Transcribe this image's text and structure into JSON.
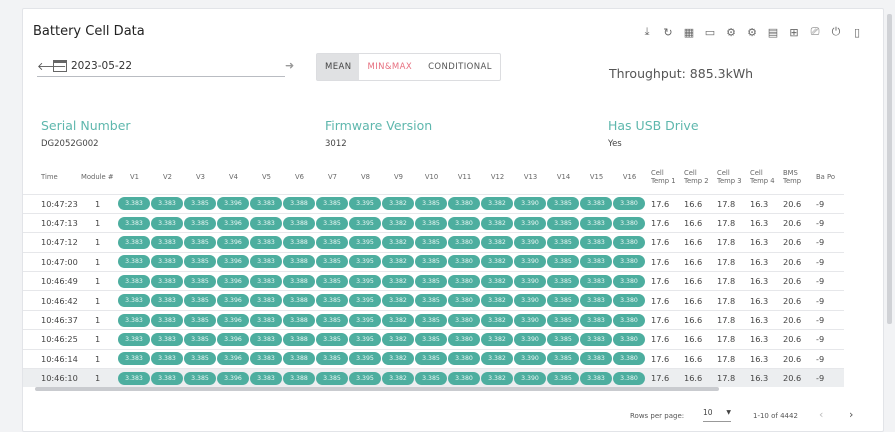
{
  "title": "Battery Cell Data",
  "toolbar_icons": [
    "download-icon",
    "refresh-icon",
    "grid-icon",
    "monitor-icon",
    "settings-cog-icon",
    "settings-alt-icon",
    "list-icon",
    "file-add-icon",
    "cast-icon",
    "power-icon",
    "battery-menu-icon"
  ],
  "toolbar_glyphs": [
    "⤓",
    "↻",
    "▦",
    "▭",
    "⚙",
    "⚙",
    "▤",
    "⊞",
    "⎚",
    "⏻",
    "▯"
  ],
  "date": "2023-05-22",
  "modes": [
    "MEAN",
    "MIN",
    "&",
    "MAX",
    "CONDITIONAL"
  ],
  "throughput": "Throughput: 885.3kWh",
  "info": [
    {
      "label": "Serial Number",
      "value": "DG2052G002"
    },
    {
      "label": "Firmware Version",
      "value": "3012"
    },
    {
      "label": "Has USB Drive",
      "value": "Yes"
    }
  ],
  "columns": [
    "Time",
    "Module #",
    "V1",
    "V2",
    "V3",
    "V4",
    "V5",
    "V6",
    "V7",
    "V8",
    "V9",
    "V10",
    "V11",
    "V12",
    "V13",
    "V14",
    "V15",
    "V16",
    "Cell Temp 1",
    "Cell Temp 2",
    "Cell Temp 3",
    "Cell Temp 4",
    "BMS Temp",
    "Ba Po"
  ],
  "rows": [
    {
      "time": "10:47:23",
      "module": "1",
      "v": [
        "3.383",
        "3.383",
        "3.385",
        "3.396",
        "3.383",
        "3.388",
        "3.385",
        "3.395",
        "3.382",
        "3.385",
        "3.380",
        "3.382",
        "3.390",
        "3.385",
        "3.383",
        "3.380"
      ],
      "t": [
        "17.6",
        "16.6",
        "17.8",
        "16.3",
        "20.6",
        "-9"
      ]
    },
    {
      "time": "10:47:13",
      "module": "1",
      "v": [
        "3.383",
        "3.383",
        "3.385",
        "3.396",
        "3.383",
        "3.388",
        "3.385",
        "3.395",
        "3.382",
        "3.385",
        "3.380",
        "3.382",
        "3.390",
        "3.385",
        "3.383",
        "3.380"
      ],
      "t": [
        "17.6",
        "16.6",
        "17.8",
        "16.3",
        "20.6",
        "-9"
      ]
    },
    {
      "time": "10:47:12",
      "module": "1",
      "v": [
        "3.383",
        "3.383",
        "3.385",
        "3.396",
        "3.383",
        "3.388",
        "3.385",
        "3.395",
        "3.382",
        "3.385",
        "3.380",
        "3.382",
        "3.390",
        "3.385",
        "3.383",
        "3.380"
      ],
      "t": [
        "17.6",
        "16.6",
        "17.8",
        "16.3",
        "20.6",
        "-9"
      ]
    },
    {
      "time": "10:47:00",
      "module": "1",
      "v": [
        "3.383",
        "3.383",
        "3.385",
        "3.396",
        "3.383",
        "3.388",
        "3.385",
        "3.395",
        "3.382",
        "3.385",
        "3.380",
        "3.382",
        "3.390",
        "3.385",
        "3.383",
        "3.380"
      ],
      "t": [
        "17.6",
        "16.6",
        "17.8",
        "16.3",
        "20.6",
        "-9"
      ]
    },
    {
      "time": "10:46:49",
      "module": "1",
      "v": [
        "3.383",
        "3.383",
        "3.385",
        "3.396",
        "3.383",
        "3.388",
        "3.385",
        "3.395",
        "3.382",
        "3.385",
        "3.380",
        "3.382",
        "3.390",
        "3.385",
        "3.383",
        "3.380"
      ],
      "t": [
        "17.6",
        "16.6",
        "17.8",
        "16.3",
        "20.6",
        "-9"
      ]
    },
    {
      "time": "10:46:42",
      "module": "1",
      "v": [
        "3.383",
        "3.383",
        "3.385",
        "3.396",
        "3.383",
        "3.388",
        "3.385",
        "3.395",
        "3.382",
        "3.385",
        "3.380",
        "3.382",
        "3.390",
        "3.385",
        "3.383",
        "3.380"
      ],
      "t": [
        "17.6",
        "16.6",
        "17.8",
        "16.3",
        "20.6",
        "-9"
      ]
    },
    {
      "time": "10:46:37",
      "module": "1",
      "v": [
        "3.383",
        "3.383",
        "3.385",
        "3.396",
        "3.383",
        "3.388",
        "3.385",
        "3.395",
        "3.382",
        "3.385",
        "3.380",
        "3.382",
        "3.390",
        "3.385",
        "3.383",
        "3.380"
      ],
      "t": [
        "17.6",
        "16.6",
        "17.8",
        "16.3",
        "20.6",
        "-9"
      ]
    },
    {
      "time": "10:46:25",
      "module": "1",
      "v": [
        "3.383",
        "3.383",
        "3.385",
        "3.396",
        "3.383",
        "3.388",
        "3.385",
        "3.395",
        "3.382",
        "3.385",
        "3.380",
        "3.382",
        "3.390",
        "3.385",
        "3.383",
        "3.380"
      ],
      "t": [
        "17.6",
        "16.6",
        "17.8",
        "16.3",
        "20.6",
        "-9"
      ]
    },
    {
      "time": "10:46:14",
      "module": "1",
      "v": [
        "3.383",
        "3.383",
        "3.385",
        "3.396",
        "3.383",
        "3.388",
        "3.385",
        "3.395",
        "3.382",
        "3.385",
        "3.380",
        "3.382",
        "3.390",
        "3.385",
        "3.383",
        "3.380"
      ],
      "t": [
        "17.6",
        "16.6",
        "17.8",
        "16.3",
        "20.6",
        "-9"
      ]
    },
    {
      "time": "10:46:10",
      "module": "1",
      "v": [
        "3.383",
        "3.383",
        "3.385",
        "3.396",
        "3.383",
        "3.388",
        "3.385",
        "3.395",
        "3.382",
        "3.385",
        "3.380",
        "3.382",
        "3.390",
        "3.385",
        "3.383",
        "3.380"
      ],
      "t": [
        "17.6",
        "16.6",
        "17.8",
        "16.3",
        "20.6",
        "-9"
      ]
    }
  ],
  "pagination": {
    "rows_per_page_label": "Rows per page:",
    "rows_per_page": "10",
    "range": "1-10 of 4442"
  },
  "colors": {
    "accent": "#4dae9f",
    "label": "#5eb7ad",
    "minmax": "#e76f7f"
  }
}
